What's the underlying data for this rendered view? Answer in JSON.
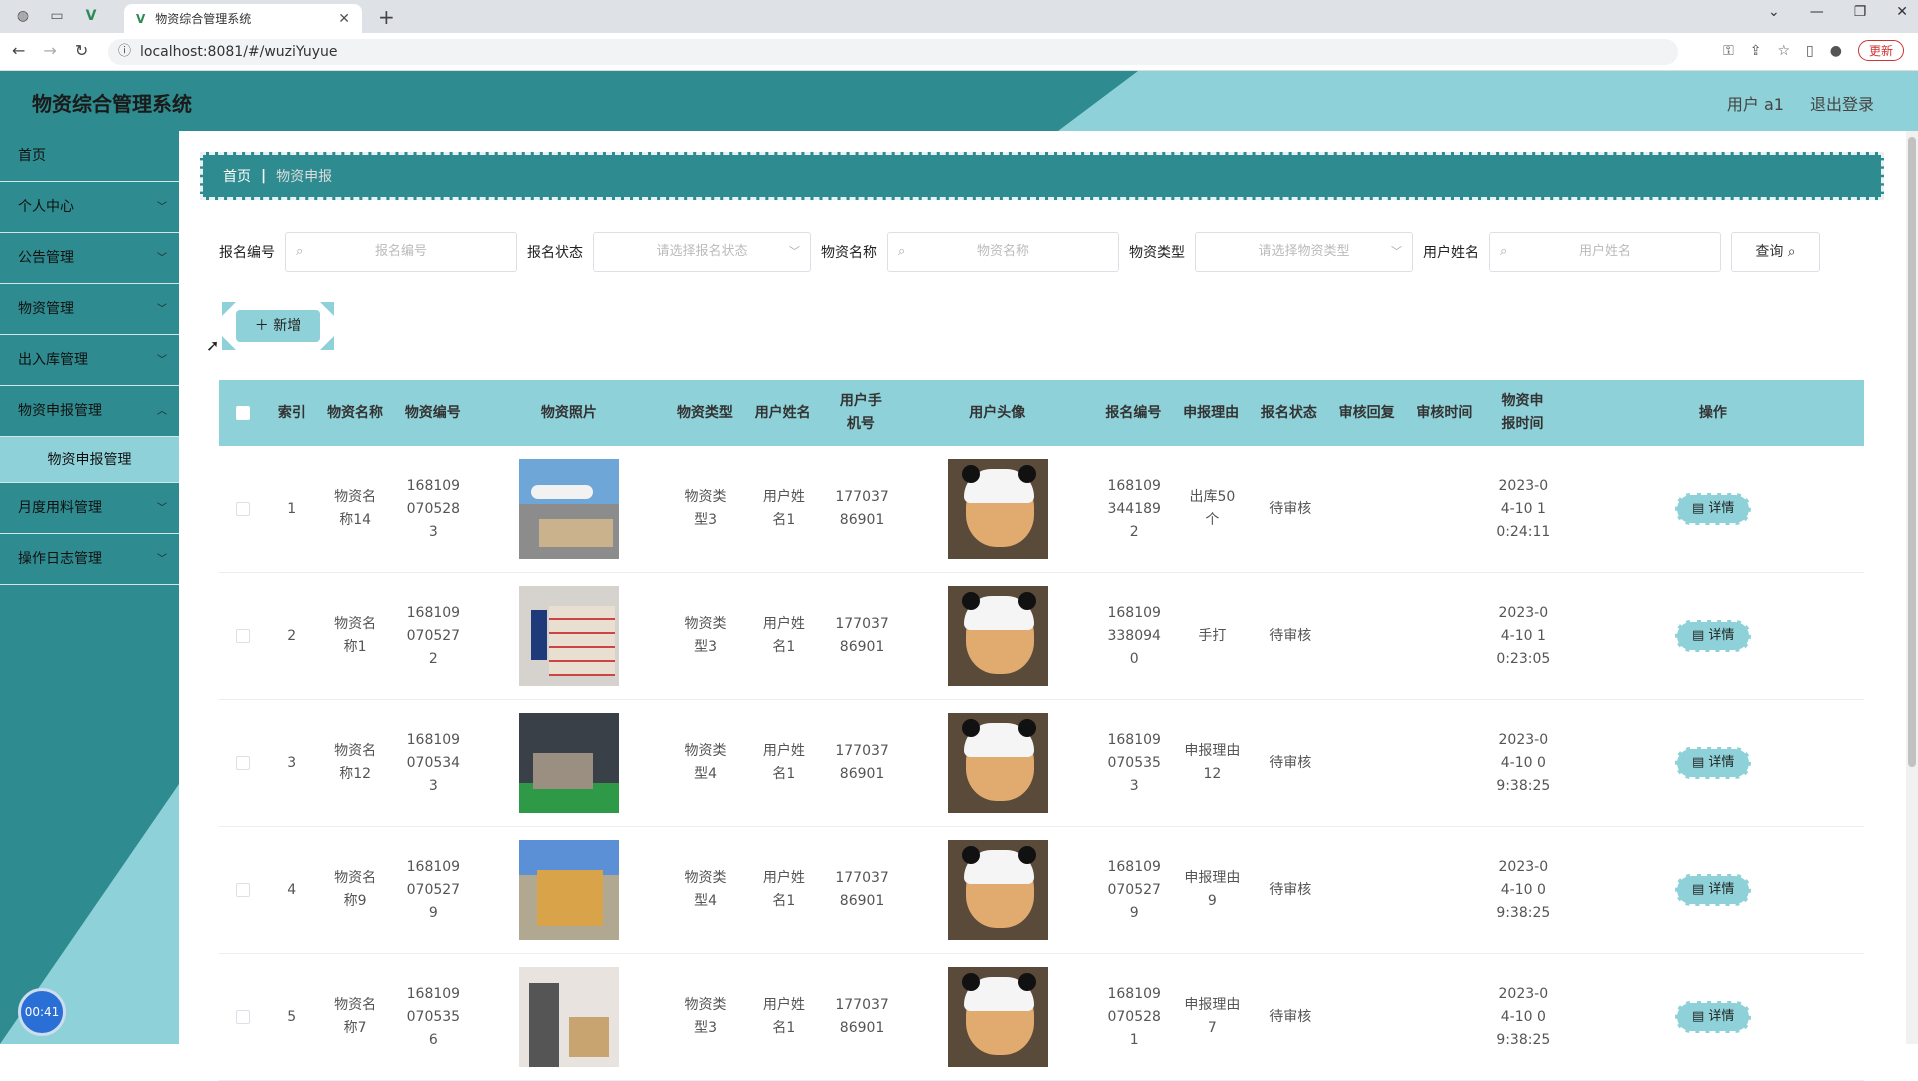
{
  "browser": {
    "tab_title": "物资综合管理系统",
    "url": "localhost:8081/#/wuziYuyue",
    "update_label": "更新"
  },
  "header": {
    "title": "物资综合管理系统",
    "user_label": "用户 a1",
    "logout_label": "退出登录"
  },
  "sidebar": {
    "items": [
      {
        "label": "首页"
      },
      {
        "label": "个人中心"
      },
      {
        "label": "公告管理"
      },
      {
        "label": "物资管理"
      },
      {
        "label": "出入库管理"
      },
      {
        "label": "物资申报管理"
      },
      {
        "label": "月度用料管理"
      },
      {
        "label": "操作日志管理"
      }
    ],
    "sub_item": "物资申报管理",
    "timer": "00:41"
  },
  "breadcrumb": {
    "home": "首页",
    "current": "物资申报"
  },
  "search": {
    "f1_label": "报名编号",
    "f1_placeholder": "报名编号",
    "f2_label": "报名状态",
    "f2_placeholder": "请选择报名状态",
    "f3_label": "物资名称",
    "f3_placeholder": "物资名称",
    "f4_label": "物资类型",
    "f4_placeholder": "请选择物资类型",
    "f5_label": "用户姓名",
    "f5_placeholder": "用户姓名",
    "query_label": "查询"
  },
  "actions": {
    "add_label": "新增"
  },
  "table": {
    "headers": [
      "索引",
      "物资名称",
      "物资编号",
      "物资照片",
      "物资类型",
      "用户姓名",
      "用户手机号",
      "用户头像",
      "报名编号",
      "申报理由",
      "报名状态",
      "审核回复",
      "审核时间",
      "物资申报时间",
      "操作"
    ],
    "detail_label": "详情",
    "rows": [
      {
        "idx": "1",
        "name": "物资名称14",
        "code": "1681090705283",
        "type": "物资类型3",
        "user": "用户姓名1",
        "phone": "17703786901",
        "apply_no": "1681093441892",
        "reason": "出库50个",
        "status": "待审核",
        "reply": "",
        "review_time": "",
        "time": "2023-04-10 10:24:11"
      },
      {
        "idx": "2",
        "name": "物资名称1",
        "code": "1681090705272",
        "type": "物资类型3",
        "user": "用户姓名1",
        "phone": "17703786901",
        "apply_no": "1681093380940",
        "reason": "手打",
        "status": "待审核",
        "reply": "",
        "review_time": "",
        "time": "2023-04-10 10:23:05"
      },
      {
        "idx": "3",
        "name": "物资名称12",
        "code": "1681090705343",
        "type": "物资类型4",
        "user": "用户姓名1",
        "phone": "17703786901",
        "apply_no": "1681090705353",
        "reason": "申报理由12",
        "status": "待审核",
        "reply": "",
        "review_time": "",
        "time": "2023-04-10 09:38:25"
      },
      {
        "idx": "4",
        "name": "物资名称9",
        "code": "1681090705279",
        "type": "物资类型4",
        "user": "用户姓名1",
        "phone": "17703786901",
        "apply_no": "1681090705279",
        "reason": "申报理由9",
        "status": "待审核",
        "reply": "",
        "review_time": "",
        "time": "2023-04-10 09:38:25"
      },
      {
        "idx": "5",
        "name": "物资名称7",
        "code": "1681090705356",
        "type": "物资类型3",
        "user": "用户姓名1",
        "phone": "17703786901",
        "apply_no": "1681090705281",
        "reason": "申报理由7",
        "status": "待审核",
        "reply": "",
        "review_time": "",
        "time": "2023-04-10 09:38:25"
      }
    ]
  }
}
